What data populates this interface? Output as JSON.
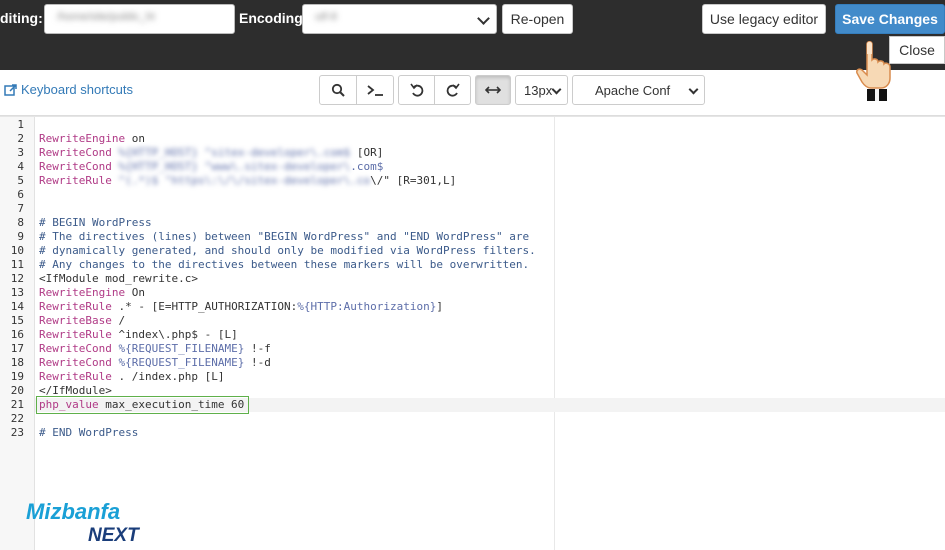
{
  "header": {
    "editing_label": "diting:",
    "editing_value": "/home/site/public_ht",
    "encoding_label": "Encoding:",
    "encoding_value": "utf-8",
    "reopen_label": "Re-open",
    "legacy_label": "Use legacy editor",
    "save_label": "Save Changes",
    "close_label": "Close"
  },
  "toolbar": {
    "keyboard_shortcuts": "Keyboard shortcuts",
    "font_size": "13px",
    "mode": "Apache Conf"
  },
  "editor": {
    "active_line": 21,
    "lines": [
      {
        "n": "1",
        "parts": []
      },
      {
        "n": "2",
        "parts": [
          {
            "c": "kw",
            "t": "RewriteEngine"
          },
          {
            "c": "",
            "t": " on"
          }
        ]
      },
      {
        "n": "3",
        "parts": [
          {
            "c": "kw",
            "t": "RewriteCond"
          },
          {
            "c": "",
            "t": " "
          },
          {
            "c": "blur",
            "t": "%{HTTP_HOST} ^sitex-developer\\.com$"
          },
          {
            "c": "",
            "t": " [OR]"
          }
        ]
      },
      {
        "n": "4",
        "parts": [
          {
            "c": "kw",
            "t": "RewriteCond"
          },
          {
            "c": "",
            "t": " "
          },
          {
            "c": "blur",
            "t": "%{HTTP_HOST} ^www\\.sitex-developer\\"
          },
          {
            "c": "var",
            "t": ".com$"
          }
        ]
      },
      {
        "n": "5",
        "parts": [
          {
            "c": "kw",
            "t": "RewriteRule"
          },
          {
            "c": "",
            "t": " "
          },
          {
            "c": "blur",
            "t": "^(.*)$ \"https\\:\\/\\/sitex-developer\\.co"
          },
          {
            "c": "",
            "t": "\\/\" [R=301,L]"
          }
        ]
      },
      {
        "n": "6",
        "parts": []
      },
      {
        "n": "7",
        "parts": []
      },
      {
        "n": "8",
        "parts": [
          {
            "c": "cm",
            "t": "# BEGIN WordPress"
          }
        ]
      },
      {
        "n": "9",
        "parts": [
          {
            "c": "cm",
            "t": "# The directives (lines) between \"BEGIN WordPress\" and \"END WordPress\" are"
          }
        ]
      },
      {
        "n": "10",
        "parts": [
          {
            "c": "cm",
            "t": "# dynamically generated, and should only be modified via WordPress filters."
          }
        ]
      },
      {
        "n": "11",
        "parts": [
          {
            "c": "cm",
            "t": "# Any changes to the directives between these markers will be overwritten."
          }
        ]
      },
      {
        "n": "12",
        "parts": [
          {
            "c": "",
            "t": "<IfModule mod_rewrite.c>"
          }
        ]
      },
      {
        "n": "13",
        "parts": [
          {
            "c": "kw",
            "t": "RewriteEngine"
          },
          {
            "c": "",
            "t": " On"
          }
        ]
      },
      {
        "n": "14",
        "parts": [
          {
            "c": "kw",
            "t": "RewriteRule"
          },
          {
            "c": "",
            "t": " .* - [E=HTTP_AUTHORIZATION:"
          },
          {
            "c": "var",
            "t": "%{HTTP:Authorization}"
          },
          {
            "c": "",
            "t": "]"
          }
        ]
      },
      {
        "n": "15",
        "parts": [
          {
            "c": "kw",
            "t": "RewriteBase"
          },
          {
            "c": "",
            "t": " /"
          }
        ]
      },
      {
        "n": "16",
        "parts": [
          {
            "c": "kw",
            "t": "RewriteRule"
          },
          {
            "c": "",
            "t": " ^index\\.php$ - [L]"
          }
        ]
      },
      {
        "n": "17",
        "parts": [
          {
            "c": "kw",
            "t": "RewriteCond"
          },
          {
            "c": "",
            "t": " "
          },
          {
            "c": "var",
            "t": "%{REQUEST_FILENAME}"
          },
          {
            "c": "",
            "t": " !-f"
          }
        ]
      },
      {
        "n": "18",
        "parts": [
          {
            "c": "kw",
            "t": "RewriteCond"
          },
          {
            "c": "",
            "t": " "
          },
          {
            "c": "var",
            "t": "%{REQUEST_FILENAME}"
          },
          {
            "c": "",
            "t": " !-d"
          }
        ]
      },
      {
        "n": "19",
        "parts": [
          {
            "c": "kw",
            "t": "RewriteRule"
          },
          {
            "c": "",
            "t": " . /index.php [L]"
          }
        ]
      },
      {
        "n": "20",
        "parts": [
          {
            "c": "",
            "t": "</IfModule>"
          }
        ]
      },
      {
        "n": "21",
        "parts": [
          {
            "c": "kw",
            "t": "php_value"
          },
          {
            "c": "",
            "t": " max_execution_time 60"
          }
        ]
      },
      {
        "n": "22",
        "parts": []
      },
      {
        "n": "23",
        "parts": [
          {
            "c": "cm",
            "t": "# END WordPress"
          }
        ]
      }
    ]
  },
  "logo": {
    "line1": "Mizbanfa",
    "line2": "NEXT"
  }
}
